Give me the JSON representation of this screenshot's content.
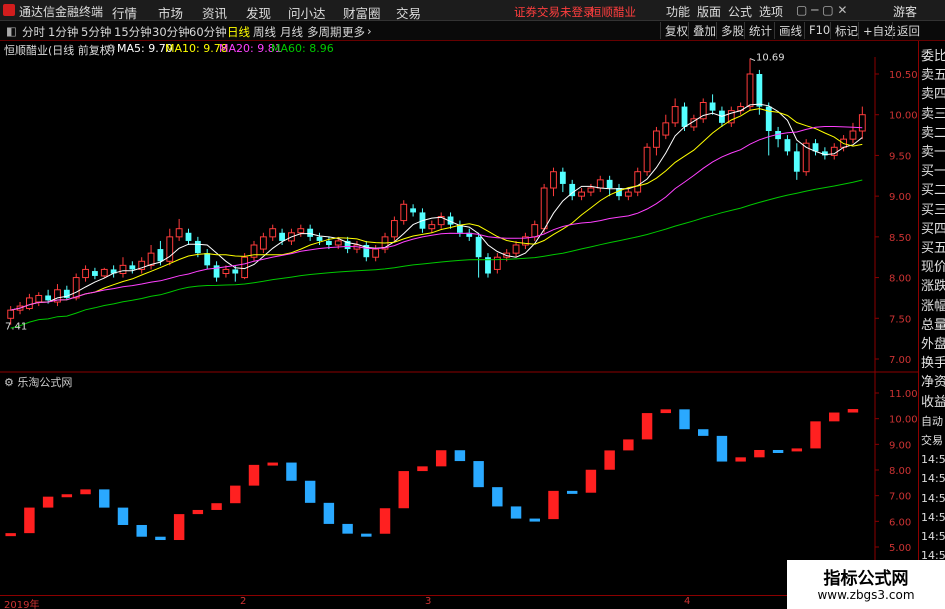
{
  "menubar": {
    "app_title": "通达信金融终端",
    "items": [
      "行情",
      "市场",
      "资讯",
      "发现",
      "问小达",
      "财富圈",
      "交易"
    ],
    "warning": "证券交易未登录",
    "stock_name": "恒顺醋业",
    "right_items": [
      "功能",
      "版面",
      "公式",
      "选项"
    ],
    "guest": "游客"
  },
  "toolbar": {
    "periods": [
      "分时",
      "1分钟",
      "5分钟",
      "15分钟",
      "30分钟",
      "60分钟",
      "日线",
      "周线",
      "月线",
      "多周期",
      "更多"
    ],
    "active_period": "日线",
    "right_buttons": [
      "复权",
      "叠加",
      "多股",
      "统计",
      "画线",
      "F10",
      "标记",
      "+自选",
      "返回"
    ]
  },
  "infobar": {
    "stock_label": "恒顺醋业(日线 前复权)",
    "ma5": "MA5: 9.70",
    "ma10": "MA10: 9.78",
    "ma20": "MA20: 9.81",
    "ma60": "MA60: 8.96",
    "colors": {
      "ma5": "#ffffff",
      "ma10": "#ffff00",
      "ma20": "#ff40ff",
      "ma60": "#00c800"
    }
  },
  "upper_axis": [
    "10.50",
    "10.00",
    "9.50",
    "9.00",
    "8.50",
    "8.00",
    "7.50",
    "7.00"
  ],
  "high_label": "10.69",
  "low_label": "7.41",
  "lower_panel": {
    "label": "乐淘公式网",
    "axis": [
      "11.00",
      "10.00",
      "9.00",
      "8.00",
      "7.00",
      "6.00",
      "5.00"
    ]
  },
  "side_panel": {
    "header": "委比",
    "items": [
      "委比",
      "卖五",
      "卖四",
      "卖三",
      "卖二",
      "卖一",
      "买一",
      "买二",
      "买三",
      "买四",
      "买五",
      "现价",
      "涨跌",
      "涨幅",
      "总量",
      "外盘",
      "换手",
      "净资",
      "收益",
      "自动",
      "交易",
      "14:56",
      "14:56",
      "14:56",
      "14:56",
      "14:56",
      "14:56",
      "14:56",
      "14:56"
    ]
  },
  "date_axis": [
    "2019年",
    "2",
    "3",
    "4"
  ],
  "watermark": {
    "line1": "指标公式网",
    "line2": "www.zbgs3.com"
  },
  "colors": {
    "up": "#ff3c3c",
    "down": "#54ffff",
    "bg": "#000000"
  },
  "chart_data": {
    "type": "candlestick",
    "y_range": [
      6.9,
      10.7
    ],
    "candles": [
      [
        7.5,
        7.6,
        7.42,
        7.65
      ],
      [
        7.6,
        7.65,
        7.55,
        7.7
      ],
      [
        7.62,
        7.75,
        7.6,
        7.8
      ],
      [
        7.7,
        7.78,
        7.65,
        7.82
      ],
      [
        7.78,
        7.72,
        7.68,
        7.85
      ],
      [
        7.7,
        7.85,
        7.65,
        7.92
      ],
      [
        7.85,
        7.75,
        7.72,
        7.9
      ],
      [
        7.75,
        8.0,
        7.72,
        8.05
      ],
      [
        8.0,
        8.1,
        7.95,
        8.15
      ],
      [
        8.08,
        8.02,
        7.98,
        8.12
      ],
      [
        8.02,
        8.1,
        8.0,
        8.12
      ],
      [
        8.1,
        8.05,
        8.0,
        8.15
      ],
      [
        8.05,
        8.15,
        8.0,
        8.25
      ],
      [
        8.15,
        8.1,
        8.05,
        8.2
      ],
      [
        8.1,
        8.2,
        8.05,
        8.25
      ],
      [
        8.15,
        8.3,
        8.1,
        8.4
      ],
      [
        8.35,
        8.2,
        8.15,
        8.45
      ],
      [
        8.2,
        8.5,
        8.15,
        8.6
      ],
      [
        8.5,
        8.6,
        8.45,
        8.72
      ],
      [
        8.55,
        8.45,
        8.4,
        8.6
      ],
      [
        8.45,
        8.3,
        8.25,
        8.5
      ],
      [
        8.3,
        8.15,
        8.1,
        8.35
      ],
      [
        8.15,
        8.0,
        7.95,
        8.2
      ],
      [
        8.05,
        8.1,
        8.0,
        8.15
      ],
      [
        8.1,
        8.05,
        7.95,
        8.15
      ],
      [
        8.0,
        8.25,
        7.98,
        8.3
      ],
      [
        8.25,
        8.4,
        8.2,
        8.45
      ],
      [
        8.35,
        8.5,
        8.3,
        8.55
      ],
      [
        8.5,
        8.6,
        8.45,
        8.65
      ],
      [
        8.55,
        8.45,
        8.4,
        8.6
      ],
      [
        8.45,
        8.55,
        8.4,
        8.6
      ],
      [
        8.55,
        8.6,
        8.5,
        8.65
      ],
      [
        8.6,
        8.5,
        8.45,
        8.65
      ],
      [
        8.5,
        8.45,
        8.4,
        8.55
      ],
      [
        8.45,
        8.4,
        8.35,
        8.5
      ],
      [
        8.4,
        8.45,
        8.35,
        8.5
      ],
      [
        8.45,
        8.35,
        8.3,
        8.5
      ],
      [
        8.35,
        8.4,
        8.3,
        8.45
      ],
      [
        8.4,
        8.25,
        8.2,
        8.45
      ],
      [
        8.25,
        8.35,
        8.2,
        8.4
      ],
      [
        8.35,
        8.5,
        8.3,
        8.55
      ],
      [
        8.5,
        8.7,
        8.45,
        8.75
      ],
      [
        8.7,
        8.9,
        8.65,
        8.95
      ],
      [
        8.85,
        8.8,
        8.75,
        8.9
      ],
      [
        8.8,
        8.6,
        8.55,
        8.85
      ],
      [
        8.6,
        8.65,
        8.55,
        8.7
      ],
      [
        8.65,
        8.75,
        8.6,
        8.8
      ],
      [
        8.75,
        8.65,
        8.6,
        8.8
      ],
      [
        8.65,
        8.55,
        8.5,
        8.7
      ],
      [
        8.55,
        8.5,
        8.45,
        8.6
      ],
      [
        8.5,
        8.25,
        8.0,
        8.55
      ],
      [
        8.25,
        8.05,
        8.0,
        8.3
      ],
      [
        8.1,
        8.25,
        8.05,
        8.3
      ],
      [
        8.25,
        8.3,
        8.2,
        8.35
      ],
      [
        8.3,
        8.4,
        8.25,
        8.45
      ],
      [
        8.4,
        8.5,
        8.35,
        8.55
      ],
      [
        8.5,
        8.65,
        8.45,
        8.7
      ],
      [
        8.6,
        9.1,
        8.55,
        9.15
      ],
      [
        9.1,
        9.3,
        9.0,
        9.35
      ],
      [
        9.3,
        9.15,
        9.05,
        9.35
      ],
      [
        9.15,
        9.0,
        8.95,
        9.2
      ],
      [
        9.0,
        9.05,
        8.95,
        9.1
      ],
      [
        9.05,
        9.1,
        9.0,
        9.15
      ],
      [
        9.1,
        9.2,
        9.05,
        9.25
      ],
      [
        9.2,
        9.1,
        9.0,
        9.25
      ],
      [
        9.1,
        9.0,
        8.95,
        9.15
      ],
      [
        9.0,
        9.05,
        8.95,
        9.1
      ],
      [
        9.05,
        9.3,
        9.0,
        9.35
      ],
      [
        9.3,
        9.6,
        9.25,
        9.65
      ],
      [
        9.6,
        9.8,
        9.5,
        9.85
      ],
      [
        9.75,
        9.9,
        9.7,
        10.0
      ],
      [
        9.9,
        10.1,
        9.85,
        10.2
      ],
      [
        10.1,
        9.85,
        9.8,
        10.15
      ],
      [
        9.85,
        9.95,
        9.8,
        10.0
      ],
      [
        9.95,
        10.15,
        9.9,
        10.2
      ],
      [
        10.15,
        10.05,
        10.0,
        10.25
      ],
      [
        10.05,
        9.9,
        9.85,
        10.1
      ],
      [
        9.9,
        10.05,
        9.85,
        10.1
      ],
      [
        10.05,
        10.1,
        10.0,
        10.15
      ],
      [
        10.1,
        10.5,
        10.05,
        10.69
      ],
      [
        10.5,
        10.1,
        10.0,
        10.55
      ],
      [
        10.1,
        9.8,
        9.5,
        10.15
      ],
      [
        9.8,
        9.7,
        9.6,
        9.85
      ],
      [
        9.7,
        9.55,
        9.5,
        9.75
      ],
      [
        9.55,
        9.3,
        9.2,
        9.65
      ],
      [
        9.3,
        9.65,
        9.25,
        9.7
      ],
      [
        9.65,
        9.55,
        9.5,
        9.7
      ],
      [
        9.55,
        9.5,
        9.45,
        9.6
      ],
      [
        9.5,
        9.6,
        9.45,
        9.65
      ],
      [
        9.6,
        9.7,
        9.55,
        9.75
      ],
      [
        9.7,
        9.8,
        9.65,
        9.9
      ],
      [
        9.8,
        10.0,
        9.7,
        10.1
      ]
    ]
  }
}
